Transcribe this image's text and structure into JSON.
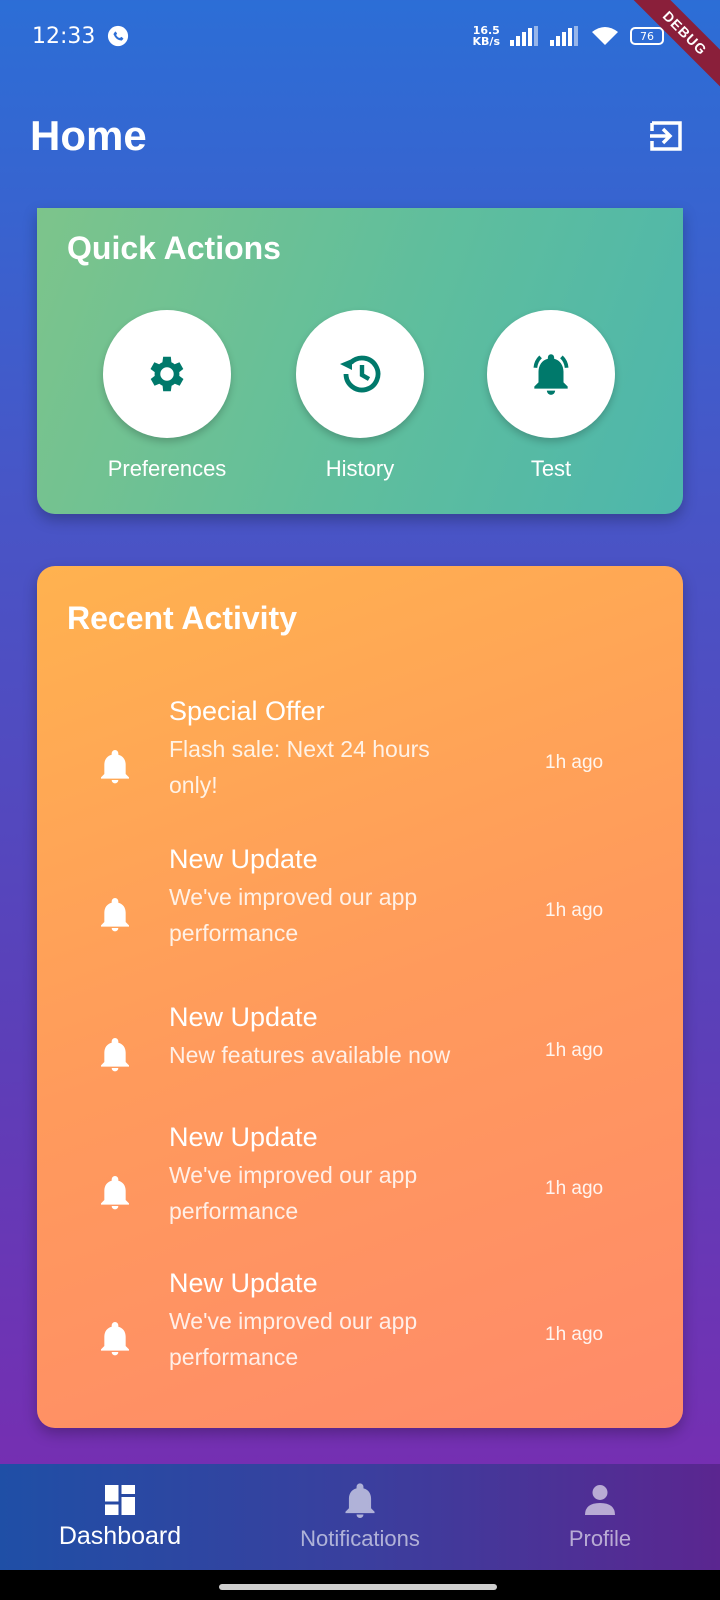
{
  "status_bar": {
    "time": "12:33",
    "net_speed_value": "16.5",
    "net_speed_unit": "KB/s",
    "battery": "76",
    "debug_label": "DEBUG"
  },
  "header": {
    "title": "Home",
    "logout_icon": "logout-icon"
  },
  "quick_actions": {
    "title": "Quick Actions",
    "items": [
      {
        "label": "Preferences",
        "icon": "gear-icon"
      },
      {
        "label": "History",
        "icon": "history-icon"
      },
      {
        "label": "Test",
        "icon": "ringing-bell-icon"
      }
    ],
    "icon_color": "#00796b"
  },
  "recent_activity": {
    "title": "Recent Activity",
    "items": [
      {
        "title": "Special Offer",
        "message_line1": "Flash sale: Next 24 hours",
        "message_line2": "only!",
        "time": "1h ago"
      },
      {
        "title": "New Update",
        "message_line1": "We've improved our app",
        "message_line2": "performance",
        "time": "1h ago"
      },
      {
        "title": "New Update",
        "message_line1": "New features available now",
        "message_line2": "",
        "time": "1h ago"
      },
      {
        "title": "New Update",
        "message_line1": "We've improved our app",
        "message_line2": "performance",
        "time": "1h ago"
      },
      {
        "title": "New Update",
        "message_line1": "We've improved our app",
        "message_line2": "performance",
        "time": "1h ago"
      }
    ]
  },
  "bottom_nav": {
    "items": [
      {
        "label": "Dashboard",
        "icon": "dashboard-icon",
        "active": true
      },
      {
        "label": "Notifications",
        "icon": "bell-icon",
        "active": false
      },
      {
        "label": "Profile",
        "icon": "person-icon",
        "active": false
      }
    ]
  }
}
